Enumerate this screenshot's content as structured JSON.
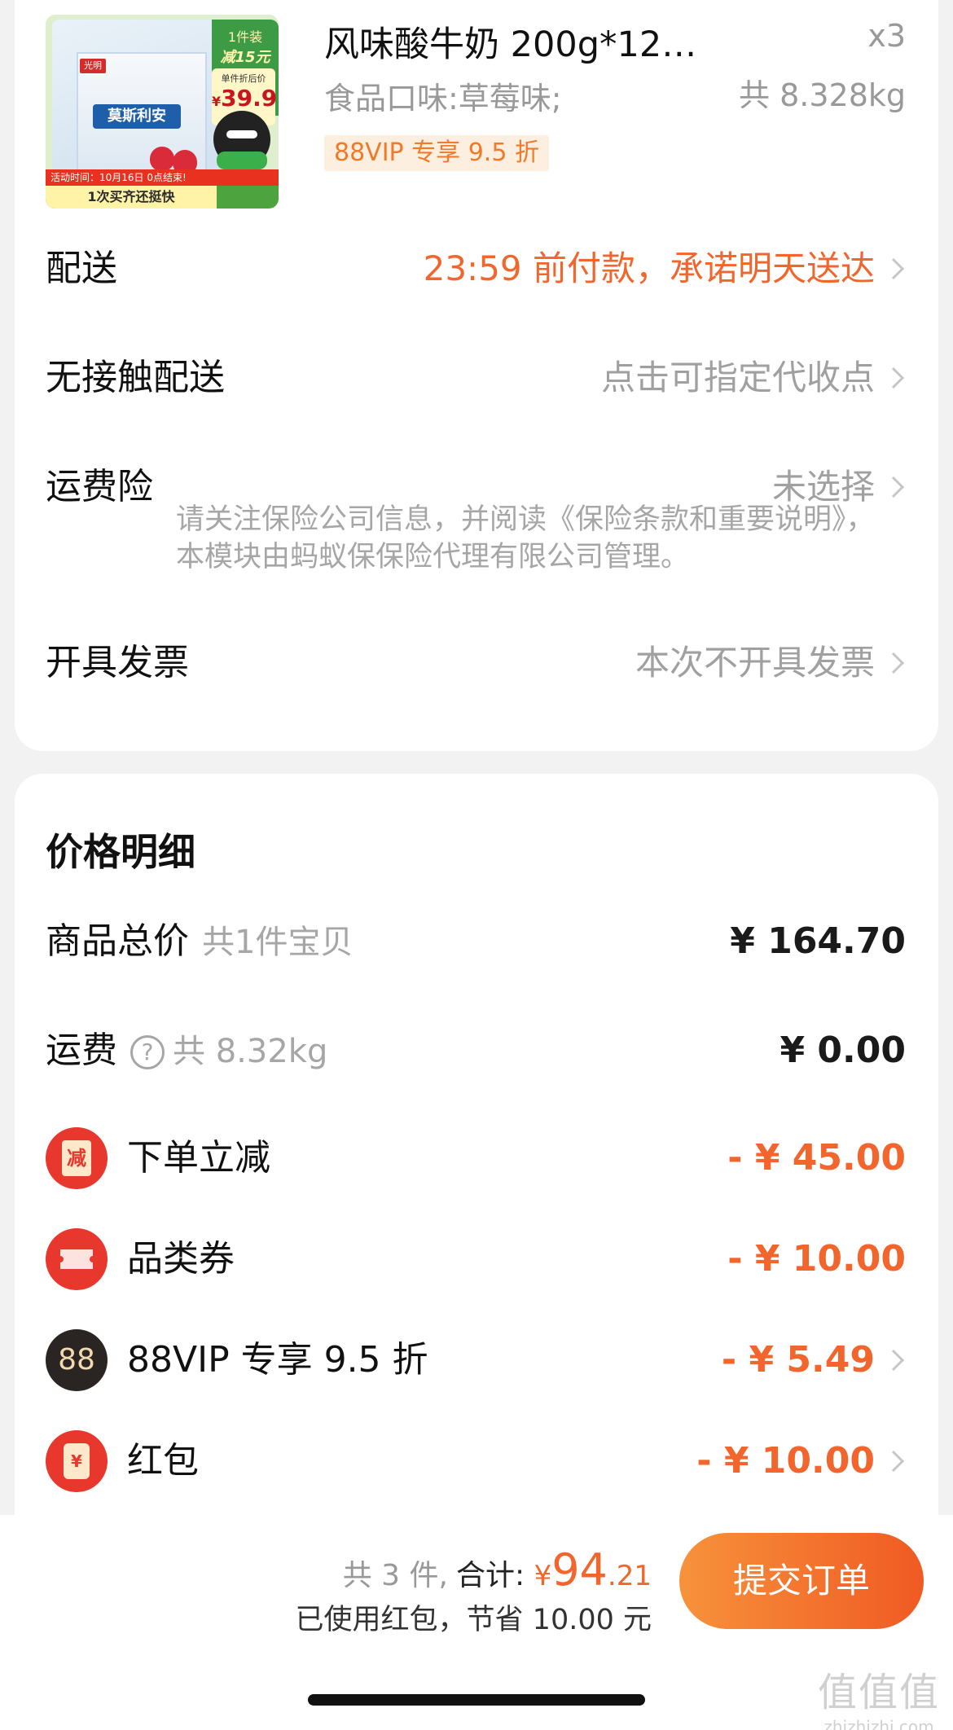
{
  "product": {
    "image": {
      "tag_quantity": "1件装",
      "tag_discount": "减15元",
      "price_label": "单件折后价",
      "price_currency": "¥",
      "price_value": "39.9",
      "brand_logo": "光明",
      "brand_name": "莫斯利安",
      "activity_text": "活动时间：10月16日 0点结束!",
      "slogan": "1次买齐还挺快"
    },
    "title": "风味酸牛奶 200g*12…",
    "quantity": "x3",
    "spec": "食品口味:草莓味;",
    "weight": "共 8.328kg",
    "vip_badge": "88VIP 专享 9.5 折"
  },
  "order_options": {
    "delivery": {
      "label": "配送",
      "value": "23:59 前付款，承诺明天送达"
    },
    "contactless": {
      "label": "无接触配送",
      "value": "点击可指定代收点"
    },
    "insurance": {
      "label": "运费险",
      "value": "未选择",
      "note": "请关注保险公司信息，并阅读《保险条款和重要说明》，本模块由蚂蚁保保险代理有限公司管理。"
    },
    "invoice": {
      "label": "开具发票",
      "value": "本次不开具发票"
    }
  },
  "price_detail": {
    "title": "价格明细",
    "goods_total": {
      "label": "商品总价",
      "sub": "共1件宝贝",
      "amount": "¥ 164.70"
    },
    "shipping": {
      "label": "运费",
      "sub": "共 8.32kg",
      "amount": "¥ 0.00"
    },
    "instant_discount": {
      "label": "下单立减",
      "icon_text": "减",
      "amount": "- ¥ 45.00"
    },
    "category_coupon": {
      "label": "品类券",
      "amount": "- ¥ 10.00"
    },
    "vip_discount": {
      "label": "88VIP 专享 9.5 折",
      "icon_text": "88",
      "amount": "- ¥ 5.49"
    },
    "red_packet": {
      "label": "红包",
      "icon_text": "¥",
      "amount": "- ¥ 10.00"
    }
  },
  "footer": {
    "count_text": "共 3 件,",
    "total_label": "合计:",
    "currency": "¥",
    "total_integer": "94",
    "total_decimal": ".21",
    "saved_text": "已使用红包，节省 10.00 元",
    "submit_label": "提交订单"
  },
  "watermark": {
    "logo": "值值值",
    "url": "zhizhizhi.com"
  },
  "colors": {
    "accent_orange": "#f2662d",
    "icon_red": "#e8372c",
    "icon_dark": "#2a2522",
    "page_bg": "#f2f2f2"
  },
  "icons": {
    "chevron": "chevron-right-icon",
    "help": "question-circle-icon"
  }
}
